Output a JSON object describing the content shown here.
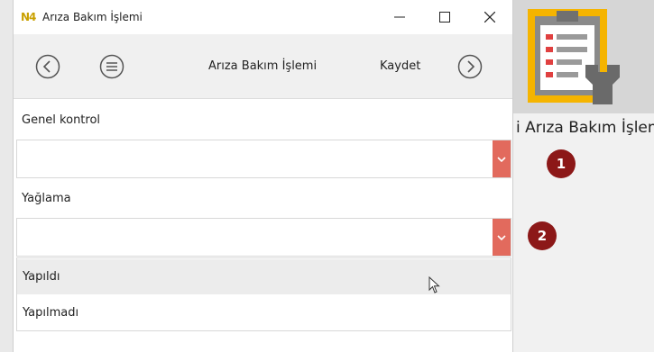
{
  "window": {
    "logo_text": "N4",
    "title": "Arıza Bakım İşlemi",
    "controls": [
      "minimize",
      "maximize",
      "close"
    ]
  },
  "navbar": {
    "back_icon": "chevron-left-circle-icon",
    "menu_icon": "menu-circle-icon",
    "title": "Arıza Bakım İşlemi",
    "save_label": "Kaydet",
    "forward_icon": "chevron-right-circle-icon"
  },
  "form": {
    "fields": [
      {
        "label": "Genel kontrol",
        "value": ""
      },
      {
        "label": "Yağlama",
        "value": ""
      }
    ],
    "dropdown_options": [
      "Yapıldı",
      "Yapılmadı"
    ],
    "hovered_option": "Yapıldı"
  },
  "background": {
    "app_label": "i Arıza Bakım İşlemi",
    "app_icon": "clipboard-wrench-icon",
    "markers": [
      "1",
      "2"
    ]
  },
  "colors": {
    "dropdown_accent": "#e26a5d",
    "marker": "#8c1818",
    "icon_frame": "#f5b400"
  }
}
